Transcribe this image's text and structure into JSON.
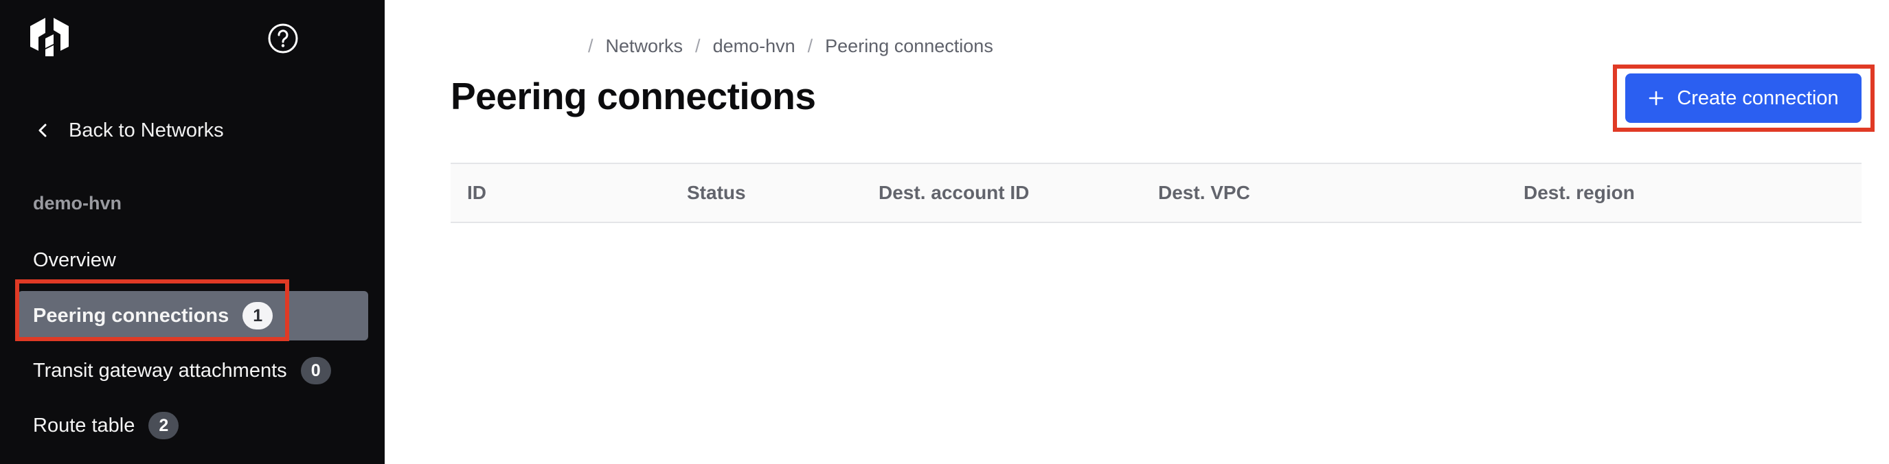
{
  "sidebar": {
    "back_label": "Back to Networks",
    "section_label": "demo-hvn",
    "items": [
      {
        "label": "Overview",
        "count": null,
        "active": false
      },
      {
        "label": "Peering connections",
        "count": "1",
        "active": true
      },
      {
        "label": "Transit gateway attachments",
        "count": "0",
        "active": false
      },
      {
        "label": "Route table",
        "count": "2",
        "active": false
      }
    ]
  },
  "breadcrumb": {
    "items": [
      "Networks",
      "demo-hvn",
      "Peering connections"
    ]
  },
  "page": {
    "title": "Peering connections",
    "create_button_label": "Create connection"
  },
  "table": {
    "columns": [
      "ID",
      "Status",
      "Dest. account ID",
      "Dest. VPC",
      "Dest. region"
    ],
    "rows": []
  },
  "colors": {
    "sidebar_bg": "#0c0c0e",
    "active_item_bg": "#656a76",
    "primary_button": "#2b5ff1",
    "highlight": "#e03a25"
  },
  "icons": {
    "logo": "hashicorp-logo-icon",
    "help": "help-circle-icon",
    "back": "chevron-left-icon",
    "create": "plus-icon"
  }
}
